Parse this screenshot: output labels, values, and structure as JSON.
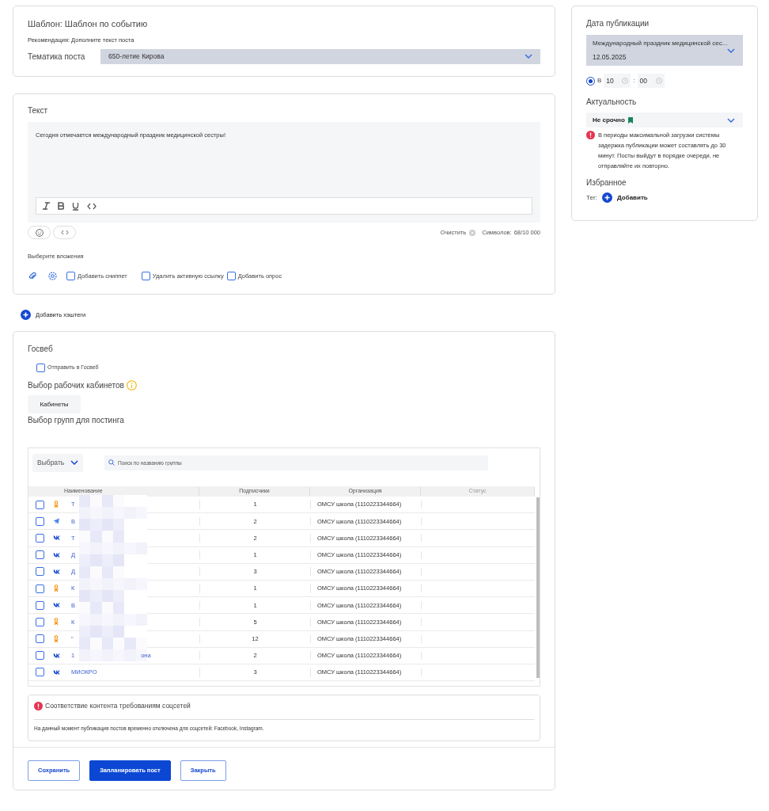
{
  "template_card": {
    "title": "Шаблон: Шаблон по событию",
    "recommendation": "Рекомендация: Дополните текст поста",
    "topic_label": "Тематика поста",
    "topic_value": "650-летие Кирова"
  },
  "text_card": {
    "title": "Текст",
    "text": "Сегодня отмечается международный праздник медицинской сестры!",
    "clear_label": "Очистить",
    "chars_label": "Символов:",
    "chars_value": "68/10 000",
    "attachments_label": "Выберите вложения",
    "options": [
      {
        "label": "Добавить сниппет",
        "checked": false
      },
      {
        "label": "Удалить активную ссылку",
        "checked": false
      },
      {
        "label": "Добавить опрос",
        "checked": false
      }
    ]
  },
  "hashtags_button": "Добавить хэштеги",
  "gosweb": {
    "title": "Госвеб",
    "send": {
      "label": "Отправить в Госвеб",
      "checked": false
    },
    "cabinets_title": "Выбор рабочих кабинетов",
    "cabinets_button": "Кабинеты",
    "groups_title": "Выбор групп для постинга",
    "select_button": "Выбрать",
    "search_placeholder": "Поиск по названию группы",
    "columns": [
      "Наименование",
      "Подписчики",
      "Организация",
      "Статус"
    ],
    "rows": [
      {
        "kind": "ok",
        "name": "Т",
        "subscribers": "1",
        "organization": "ОМСУ школа (1110223344664)",
        "checked": false
      },
      {
        "kind": "telegram",
        "name": "В",
        "subscribers": "2",
        "organization": "ОМСУ школа (1110223344664)",
        "checked": false
      },
      {
        "kind": "vk",
        "name": "Т",
        "subscribers": "2",
        "organization": "ОМСУ школа (1110223344664)",
        "checked": false
      },
      {
        "kind": "vk",
        "name": "Д",
        "subscribers": "1",
        "organization": "ОМСУ школа (1110223344664)",
        "checked": false
      },
      {
        "kind": "vk",
        "name": "Д",
        "subscribers": "3",
        "organization": "ОМСУ школа (1110223344664)",
        "checked": false
      },
      {
        "kind": "ok",
        "name": "К",
        "subscribers": "1",
        "organization": "ОМСУ школа (1110223344664)",
        "checked": false
      },
      {
        "kind": "vk",
        "name": "В",
        "subscribers": "1",
        "organization": "ОМСУ школа (1110223344664)",
        "checked": false
      },
      {
        "kind": "ok",
        "name": "К",
        "subscribers": "5",
        "organization": "ОМСУ школа (1110223344664)",
        "checked": false
      },
      {
        "kind": "ok",
        "name": "\"",
        "subscribers": "12",
        "organization": "ОМСУ школа (1110223344664)",
        "checked": false
      },
      {
        "kind": "vk",
        "name": "1",
        "name_tail": "она",
        "subscribers": "2",
        "organization": "ОМСУ школа (1110223344664)",
        "checked": false
      },
      {
        "kind": "vk",
        "name": "МИОКРО",
        "subscribers": "3",
        "organization": "ОМСУ школа (1110223344664)",
        "checked": false
      }
    ],
    "notice": {
      "title": "Соответствие контента требованиям соцсетей",
      "text": "На данный момент публикация постов временно отключена для соцсетей: Facebook, Instagram."
    }
  },
  "buttons": [
    {
      "label": "Сохранить",
      "kind": "outline"
    },
    {
      "label": "Запланировать пост",
      "kind": "primary"
    },
    {
      "label": "Закрыть",
      "kind": "outline"
    }
  ],
  "publication": {
    "title": "Дата публикации",
    "event": "Международный праздник медицинской сес...",
    "date": "12.05.2025",
    "at_time": {
      "label": "В",
      "selected": true
    },
    "hour": "10",
    "separator": ":",
    "minute": "00",
    "relevance_title": "Актуальность",
    "relevance_value": "Не срочно",
    "warning": "В периоды максимальной загрузки системы задержка публикации может составлять до 30 минут. Посты выйдут в порядке очереди, не отправляйте их повторно.",
    "favorites_title": "Избранное",
    "tag_label": "Тег:",
    "tag_add": "Добавить"
  }
}
